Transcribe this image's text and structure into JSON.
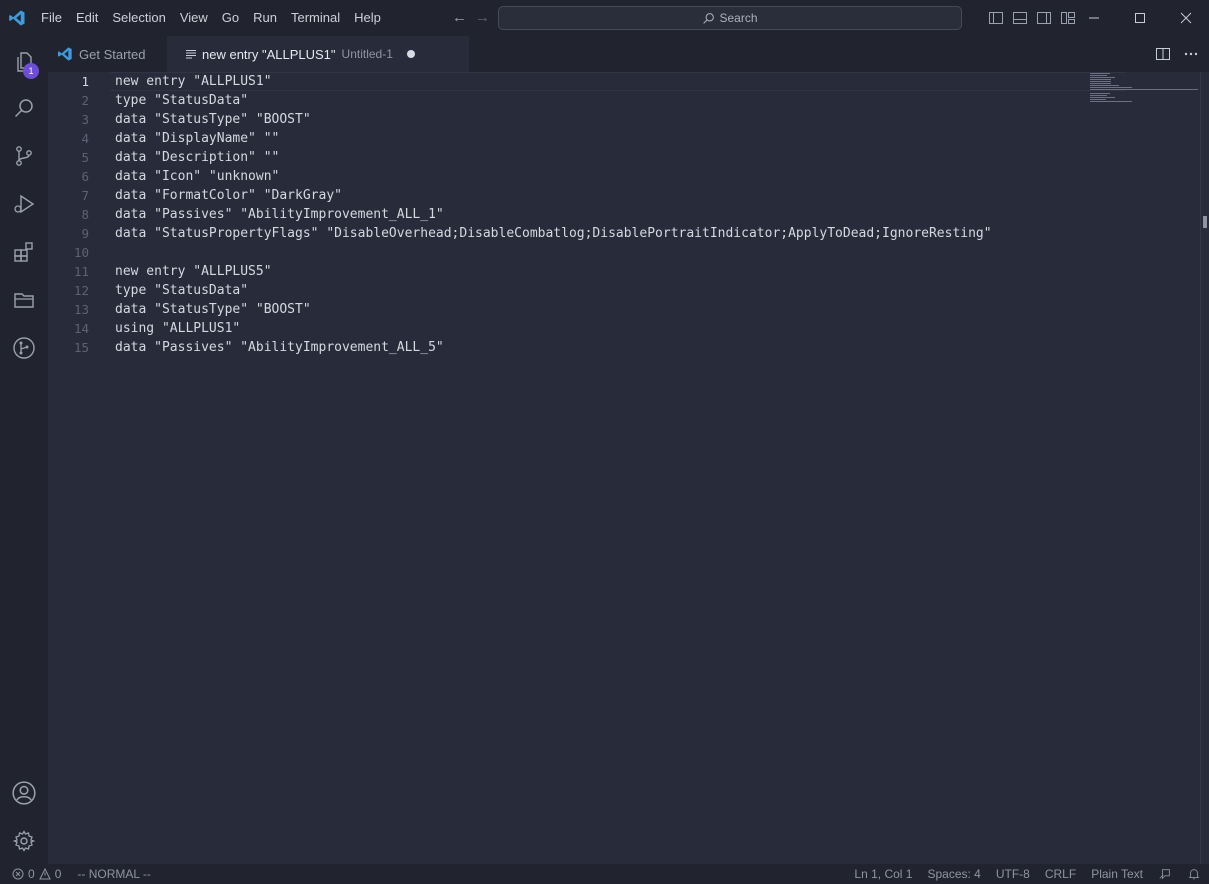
{
  "menu": [
    "File",
    "Edit",
    "Selection",
    "View",
    "Go",
    "Run",
    "Terminal",
    "Help"
  ],
  "search": {
    "label": "Search"
  },
  "explorer_badge": "1",
  "tabs": {
    "get_started": "Get Started",
    "active_title": "new entry \"ALLPLUS1\"",
    "active_desc": "Untitled-1"
  },
  "editor": {
    "lines": [
      {
        "num": "1",
        "text": "new entry \"ALLPLUS1\""
      },
      {
        "num": "2",
        "text": "type \"StatusData\""
      },
      {
        "num": "3",
        "text": "data \"StatusType\" \"BOOST\""
      },
      {
        "num": "4",
        "text": "data \"DisplayName\" \"\""
      },
      {
        "num": "5",
        "text": "data \"Description\" \"\""
      },
      {
        "num": "6",
        "text": "data \"Icon\" \"unknown\""
      },
      {
        "num": "7",
        "text": "data \"FormatColor\" \"DarkGray\""
      },
      {
        "num": "8",
        "text": "data \"Passives\" \"AbilityImprovement_ALL_1\""
      },
      {
        "num": "9",
        "text": "data \"StatusPropertyFlags\" \"DisableOverhead;DisableCombatlog;DisablePortraitIndicator;ApplyToDead;IgnoreResting\""
      },
      {
        "num": "10",
        "text": ""
      },
      {
        "num": "11",
        "text": "new entry \"ALLPLUS5\""
      },
      {
        "num": "12",
        "text": "type \"StatusData\""
      },
      {
        "num": "13",
        "text": "data \"StatusType\" \"BOOST\""
      },
      {
        "num": "14",
        "text": "using \"ALLPLUS1\""
      },
      {
        "num": "15",
        "text": "data \"Passives\" \"AbilityImprovement_ALL_5\""
      }
    ]
  },
  "status": {
    "errors": "0",
    "warnings": "0",
    "mode": "-- NORMAL --",
    "position": "Ln 1, Col 1",
    "spaces": "Spaces: 4",
    "encoding": "UTF-8",
    "eol": "CRLF",
    "language": "Plain Text"
  },
  "colors": {
    "background": "#282c3a",
    "chrome": "#21242f",
    "accent_badge": "#6c4ed9",
    "logo": "#3b9bdc"
  }
}
